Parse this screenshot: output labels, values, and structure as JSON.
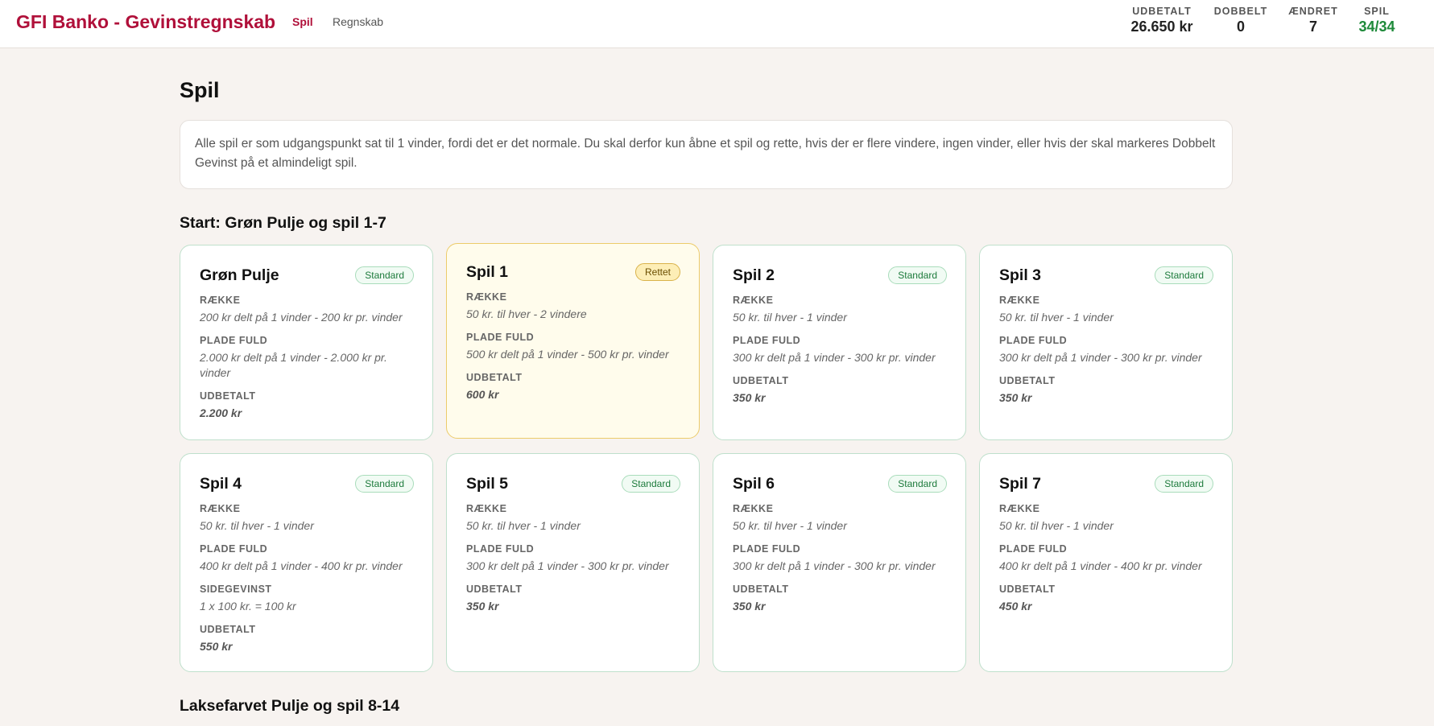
{
  "header": {
    "brand": "GFI Banko - Gevinstregnskab",
    "nav": {
      "spil": "Spil",
      "regnskab": "Regnskab"
    },
    "stats": {
      "udbetalt": {
        "label": "UDBETALT",
        "value": "26.650 kr"
      },
      "dobbelt": {
        "label": "DOBBELT",
        "value": "0"
      },
      "aendret": {
        "label": "ÆNDRET",
        "value": "7"
      },
      "spil": {
        "label": "SPIL",
        "value": "34/34"
      }
    },
    "accent_color": "#b0103a",
    "success_color": "#1e8a3a"
  },
  "page": {
    "title": "Spil",
    "info": "Alle spil er som udgangspunkt sat til 1 vinder, fordi det er det normale. Du skal derfor kun åbne et spil og rette, hvis der er flere vindere, ingen vinder, eller hvis der skal markeres Dobbelt Gevinst på et almindeligt spil."
  },
  "labels": {
    "raekke": "RÆKKE",
    "plade_fuld": "PLADE FULD",
    "sidegevinst": "SIDEGEVINST",
    "udbetalt": "UDBETALT"
  },
  "sections": [
    {
      "title": "Start: Grøn Pulje og spil 1-7",
      "cards": [
        {
          "title": "Grøn Pulje",
          "badge": "Standard",
          "raekke": "200 kr delt på 1 vinder - 200 kr pr. vinder",
          "plade_fuld": "2.000 kr delt på 1 vinder - 2.000 kr pr. vinder",
          "udbetalt": "2.200 kr"
        },
        {
          "title": "Spil 1",
          "badge": "Rettet",
          "raekke": "50 kr. til hver - 2 vindere",
          "plade_fuld": "500 kr delt på 1 vinder - 500 kr pr. vinder",
          "udbetalt": "600 kr"
        },
        {
          "title": "Spil 2",
          "badge": "Standard",
          "raekke": "50 kr. til hver - 1 vinder",
          "plade_fuld": "300 kr delt på 1 vinder - 300 kr pr. vinder",
          "udbetalt": "350 kr"
        },
        {
          "title": "Spil 3",
          "badge": "Standard",
          "raekke": "50 kr. til hver - 1 vinder",
          "plade_fuld": "300 kr delt på 1 vinder - 300 kr pr. vinder",
          "udbetalt": "350 kr"
        },
        {
          "title": "Spil 4",
          "badge": "Standard",
          "raekke": "50 kr. til hver - 1 vinder",
          "plade_fuld": "400 kr delt på 1 vinder - 400 kr pr. vinder",
          "sidegevinst": "1 x 100 kr. = 100 kr",
          "udbetalt": "550 kr"
        },
        {
          "title": "Spil 5",
          "badge": "Standard",
          "raekke": "50 kr. til hver - 1 vinder",
          "plade_fuld": "300 kr delt på 1 vinder - 300 kr pr. vinder",
          "udbetalt": "350 kr"
        },
        {
          "title": "Spil 6",
          "badge": "Standard",
          "raekke": "50 kr. til hver - 1 vinder",
          "plade_fuld": "300 kr delt på 1 vinder - 300 kr pr. vinder",
          "udbetalt": "350 kr"
        },
        {
          "title": "Spil 7",
          "badge": "Standard",
          "raekke": "50 kr. til hver - 1 vinder",
          "plade_fuld": "400 kr delt på 1 vinder - 400 kr pr. vinder",
          "udbetalt": "450 kr"
        }
      ]
    },
    {
      "title": "Laksefarvet Pulje og spil 8-14"
    }
  ]
}
